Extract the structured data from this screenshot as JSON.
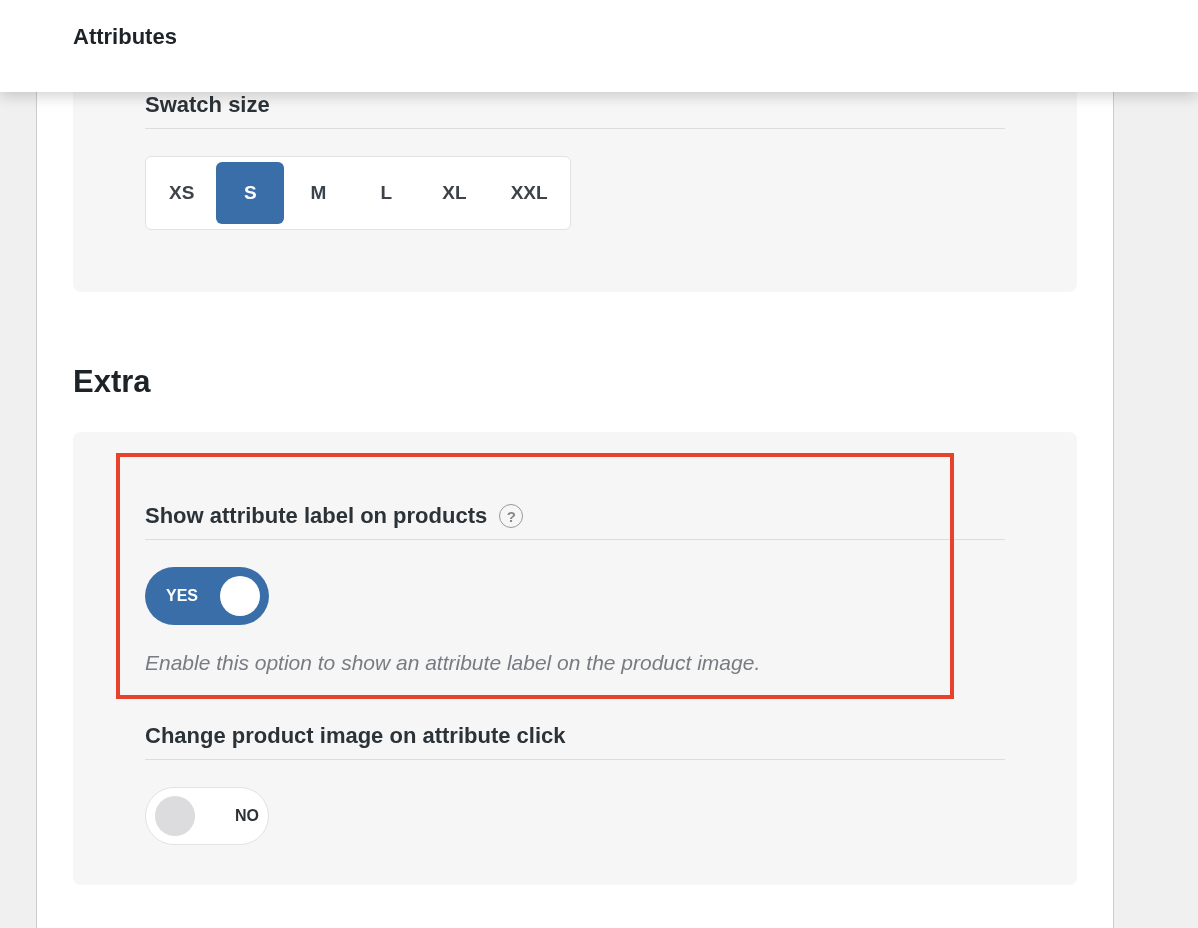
{
  "header": {
    "title": "Attributes"
  },
  "swatch_card": {
    "title": "Swatch size",
    "sizes": [
      {
        "label": "XS",
        "selected": false
      },
      {
        "label": "S",
        "selected": true
      },
      {
        "label": "M",
        "selected": false
      },
      {
        "label": "L",
        "selected": false
      },
      {
        "label": "XL",
        "selected": false
      },
      {
        "label": "XXL",
        "selected": false
      }
    ]
  },
  "extra": {
    "heading": "Extra",
    "settings": [
      {
        "title": "Show attribute label on products",
        "help": "?",
        "toggle": {
          "on": true,
          "label": "YES"
        },
        "description": "Enable this option to show an attribute label on the product image.",
        "highlighted": true
      },
      {
        "title": "Change product image on attribute click",
        "toggle": {
          "on": false,
          "label": "NO"
        }
      }
    ]
  }
}
